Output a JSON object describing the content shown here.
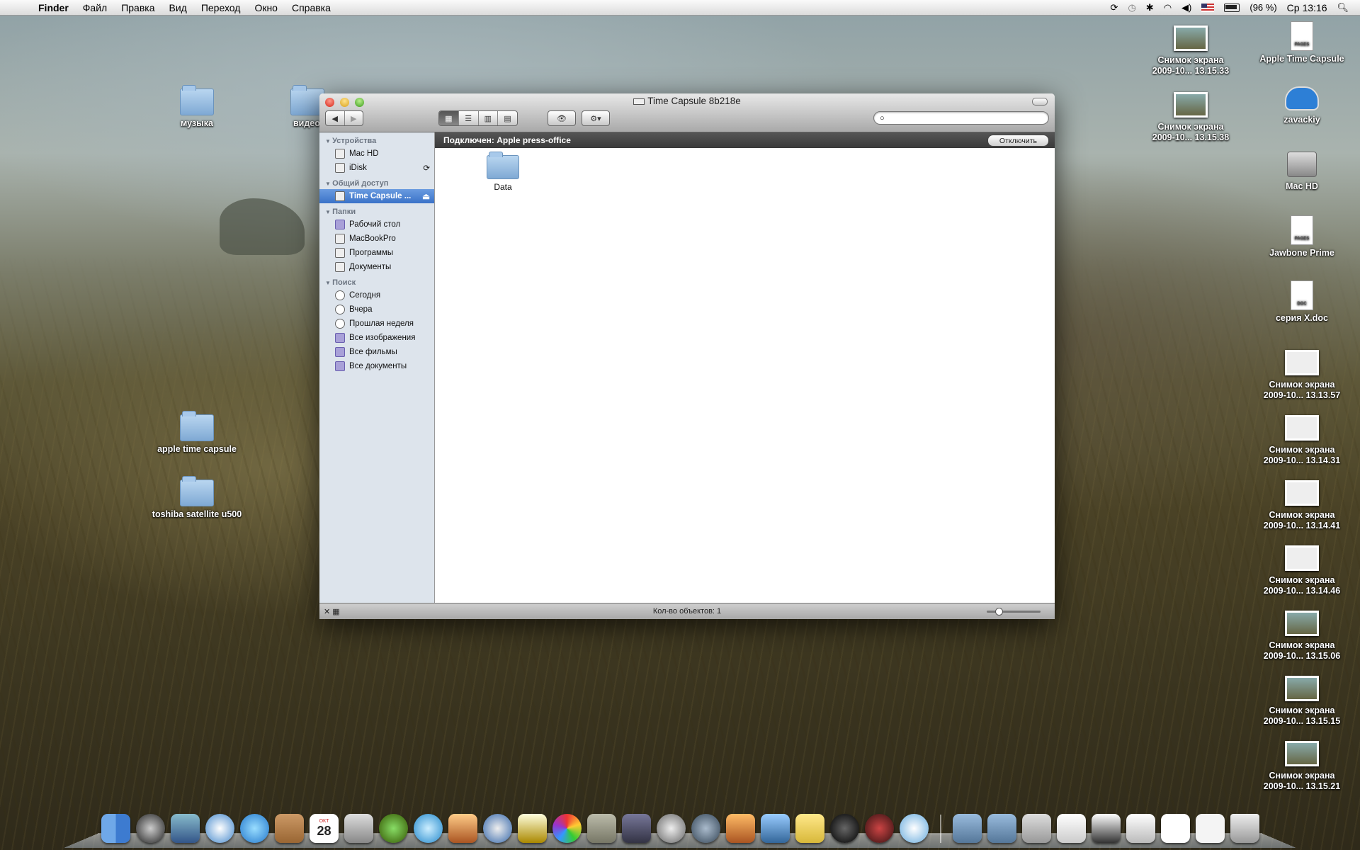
{
  "menubar": {
    "apple": "",
    "app": "Finder",
    "items": [
      "Файл",
      "Правка",
      "Вид",
      "Переход",
      "Окно",
      "Справка"
    ],
    "battery": "(96 %)",
    "clock": "Ср 13:16"
  },
  "desktop_left": [
    {
      "label": "музыка"
    },
    {
      "label": "видео"
    },
    {
      "label": "apple time capsule"
    },
    {
      "label": "toshiba satellite u500"
    }
  ],
  "desktop_right": [
    {
      "l1": "Снимок экрана",
      "l2": "2009-10... 13.15.33"
    },
    {
      "l1": "Apple Time Capsule",
      "l2": ""
    },
    {
      "l1": "Снимок экрана",
      "l2": "2009-10... 13.15.38"
    },
    {
      "l1": "zavackiy",
      "l2": ""
    },
    {
      "l1": "Mac HD",
      "l2": ""
    },
    {
      "l1": "Jawbone Prime",
      "l2": ""
    },
    {
      "l1": "серия X.doc",
      "l2": ""
    },
    {
      "l1": "Снимок экрана",
      "l2": "2009-10... 13.13.57"
    },
    {
      "l1": "Снимок экрана",
      "l2": "2009-10... 13.14.31"
    },
    {
      "l1": "Снимок экрана",
      "l2": "2009-10... 13.14.41"
    },
    {
      "l1": "Снимок экрана",
      "l2": "2009-10... 13.14.46"
    },
    {
      "l1": "Снимок экрана",
      "l2": "2009-10... 13.15.06"
    },
    {
      "l1": "Снимок экрана",
      "l2": "2009-10... 13.15.15"
    },
    {
      "l1": "Снимок экрана",
      "l2": "2009-10... 13.15.21"
    }
  ],
  "doc_badges": {
    "pages": "PAGES",
    "doc": "DOC"
  },
  "window": {
    "title": "Time Capsule 8b218e",
    "nav_back": "◀",
    "nav_fwd": "▶",
    "quicklook": "👁",
    "action": "⚙▾",
    "search_placeholder": "",
    "connected_text": "Подключен: Apple press-office",
    "disconnect_label": "Отключить",
    "status_text": "Кол-во объектов: 1",
    "items": [
      {
        "name": "Data"
      }
    ]
  },
  "sidebar": {
    "devices": {
      "title": "Устройства",
      "items": [
        "Mac HD",
        "iDisk"
      ]
    },
    "shared": {
      "title": "Общий доступ",
      "items": [
        "Time Capsule ..."
      ]
    },
    "places": {
      "title": "Папки",
      "items": [
        "Рабочий стол",
        "MacBookPro",
        "Программы",
        "Документы"
      ]
    },
    "search": {
      "title": "Поиск",
      "items": [
        "Сегодня",
        "Вчера",
        "Прошлая неделя",
        "Все изображения",
        "Все фильмы",
        "Все документы"
      ]
    }
  },
  "dock": {
    "calendar_day": "28",
    "calendar_month": "ОКТ"
  },
  "colors": {
    "selection": "#3a72c8",
    "sidebar_bg": "#dde4ec"
  }
}
